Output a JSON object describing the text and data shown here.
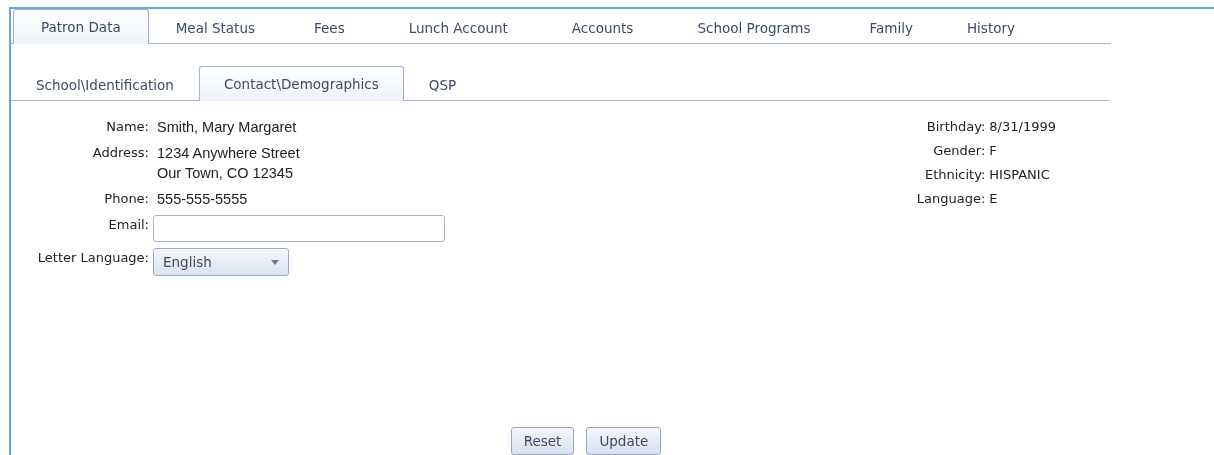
{
  "tabs": [
    {
      "label": "Patron Data",
      "selected": true
    },
    {
      "label": "Meal Status",
      "selected": false
    },
    {
      "label": "Fees",
      "selected": false
    },
    {
      "label": "Lunch Account",
      "selected": false
    },
    {
      "label": "Accounts",
      "selected": false
    },
    {
      "label": "School Programs",
      "selected": false
    },
    {
      "label": "Family",
      "selected": false
    },
    {
      "label": "History",
      "selected": false
    }
  ],
  "subtabs": [
    {
      "label": "School\\Identification",
      "selected": false
    },
    {
      "label": "Contact\\Demographics",
      "selected": true
    },
    {
      "label": "QSP",
      "selected": false
    }
  ],
  "contact": [
    {
      "kind": "text",
      "label": "Name:",
      "lines": [
        "Smith, Mary Margaret"
      ]
    },
    {
      "kind": "text",
      "label": "Address:",
      "lines": [
        "1234 Anywhere Street",
        "Our Town, CO 12345"
      ]
    },
    {
      "kind": "text",
      "label": "Phone:",
      "lines": [
        "555-555-5555"
      ]
    },
    {
      "kind": "input",
      "label": "Email:"
    },
    {
      "kind": "select",
      "label": "Letter Language:",
      "value": "English"
    }
  ],
  "demographics": [
    {
      "label": "Birthday:",
      "value": "8/31/1999"
    },
    {
      "label": "Gender:",
      "value": "F"
    },
    {
      "label": "Ethnicity:",
      "value": "HISPANIC"
    },
    {
      "label": "Language:",
      "value": "E"
    }
  ],
  "buttons": [
    "Reset",
    "Update"
  ]
}
